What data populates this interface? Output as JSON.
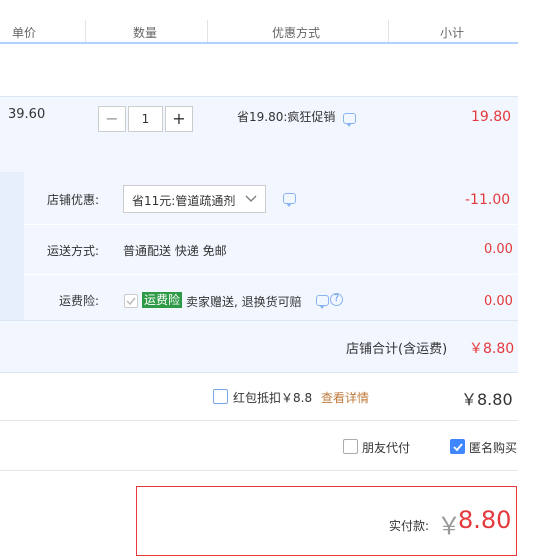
{
  "header": {
    "col_price": "单价",
    "col_qty": "数量",
    "col_promo": "优惠方式",
    "col_subtotal": "小计"
  },
  "item": {
    "price": "39.60",
    "quantity": "1",
    "minus": "−",
    "plus": "+",
    "promo": "省19.80:疯狂促销",
    "subtotal": "19.80"
  },
  "shop": {
    "discount_label": "店铺优惠:",
    "discount_value": "省11元:管道疏通剂",
    "discount_amount": "-11.00",
    "shipping_label": "运送方式:",
    "shipping_value": "普通配送 快递 免邮",
    "shipping_amount": "0.00",
    "insurance_label": "运费险:",
    "insurance_tag": "运费险",
    "insurance_desc": "卖家赠送, 退换货可赔",
    "insurance_amount": "0.00",
    "total_label": "店铺合计(含运费)",
    "total_value": "￥8.80"
  },
  "redpacket": {
    "label": "红包抵扣￥8.8",
    "link": "查看详情",
    "amount": "￥8.80"
  },
  "options": {
    "friend_pay": "朋友代付",
    "anonymous": "匿名购买",
    "friend_checked": false,
    "anonymous_checked": true
  },
  "pay": {
    "label": "实付款:",
    "currency": "￥",
    "amount": "8.80"
  },
  "colors": {
    "accent": "#e4393c",
    "blue": "#3f86ff",
    "tag_green": "#2e9a46"
  }
}
